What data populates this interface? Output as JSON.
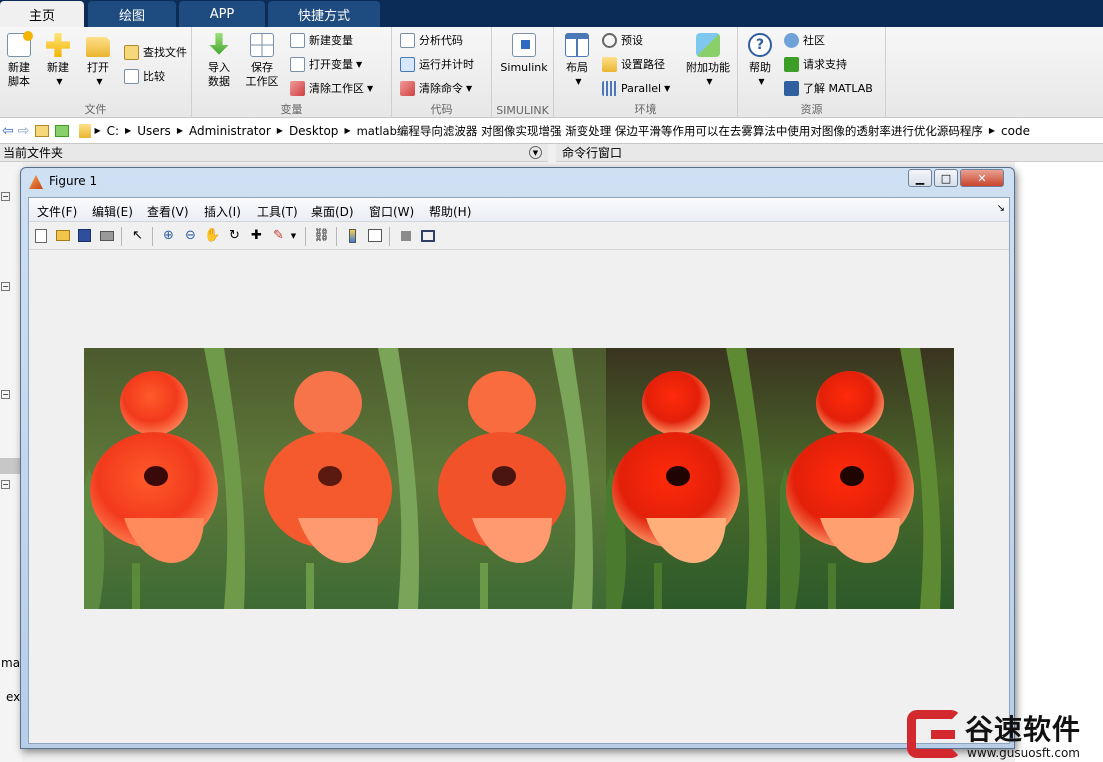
{
  "tabs": [
    {
      "label": "主页",
      "active": true
    },
    {
      "label": "绘图",
      "active": false
    },
    {
      "label": "APP",
      "active": false
    },
    {
      "label": "快捷方式",
      "active": false
    }
  ],
  "ribbon": {
    "file": {
      "label": "文件",
      "new_script": "新建\n脚本",
      "new": "新建",
      "open": "打开",
      "find_files": "查找文件",
      "compare": "比较"
    },
    "variable": {
      "label": "变量",
      "import": "导入\n数据",
      "save_ws": "保存\n工作区",
      "new_var": "新建变量",
      "open_var": "打开变量",
      "clear_ws": "清除工作区"
    },
    "code": {
      "label": "代码",
      "analyze": "分析代码",
      "run_time": "运行并计时",
      "clear_cmd": "清除命令"
    },
    "simulink": {
      "label": "SIMULINK",
      "simulink": "Simulink"
    },
    "env": {
      "label": "环境",
      "layout": "布局",
      "prefs": "预设",
      "set_path": "设置路径",
      "parallel": "Parallel",
      "addons": "附加功能"
    },
    "res": {
      "label": "资源",
      "help": "帮助",
      "community": "社区",
      "support": "请求支持",
      "learn": "了解 MATLAB"
    }
  },
  "address": {
    "crumbs": [
      "C:",
      "Users",
      "Administrator",
      "Desktop",
      "matlab编程导向滤波器 对图像实现增强 渐变处理 保边平滑等作用可以在去雾算法中使用对图像的透射率进行优化源码程序",
      "code"
    ]
  },
  "panels": {
    "current_folder": "当前文件夹",
    "command_window": "命令行窗口",
    "left_snip1": "ma",
    "left_snip2": "ex"
  },
  "figure": {
    "title": "Figure 1",
    "menus": [
      "文件(F)",
      "编辑(E)",
      "查看(V)",
      "插入(I)",
      "工具(T)",
      "桌面(D)",
      "窗口(W)",
      "帮助(H)"
    ]
  },
  "watermark": {
    "brand": "谷速软件",
    "url": "www.gusuosft.com"
  },
  "colors": {
    "tabstrip": "#0b2c57",
    "tab": "#1e4b80",
    "accent": "#d4282f"
  }
}
